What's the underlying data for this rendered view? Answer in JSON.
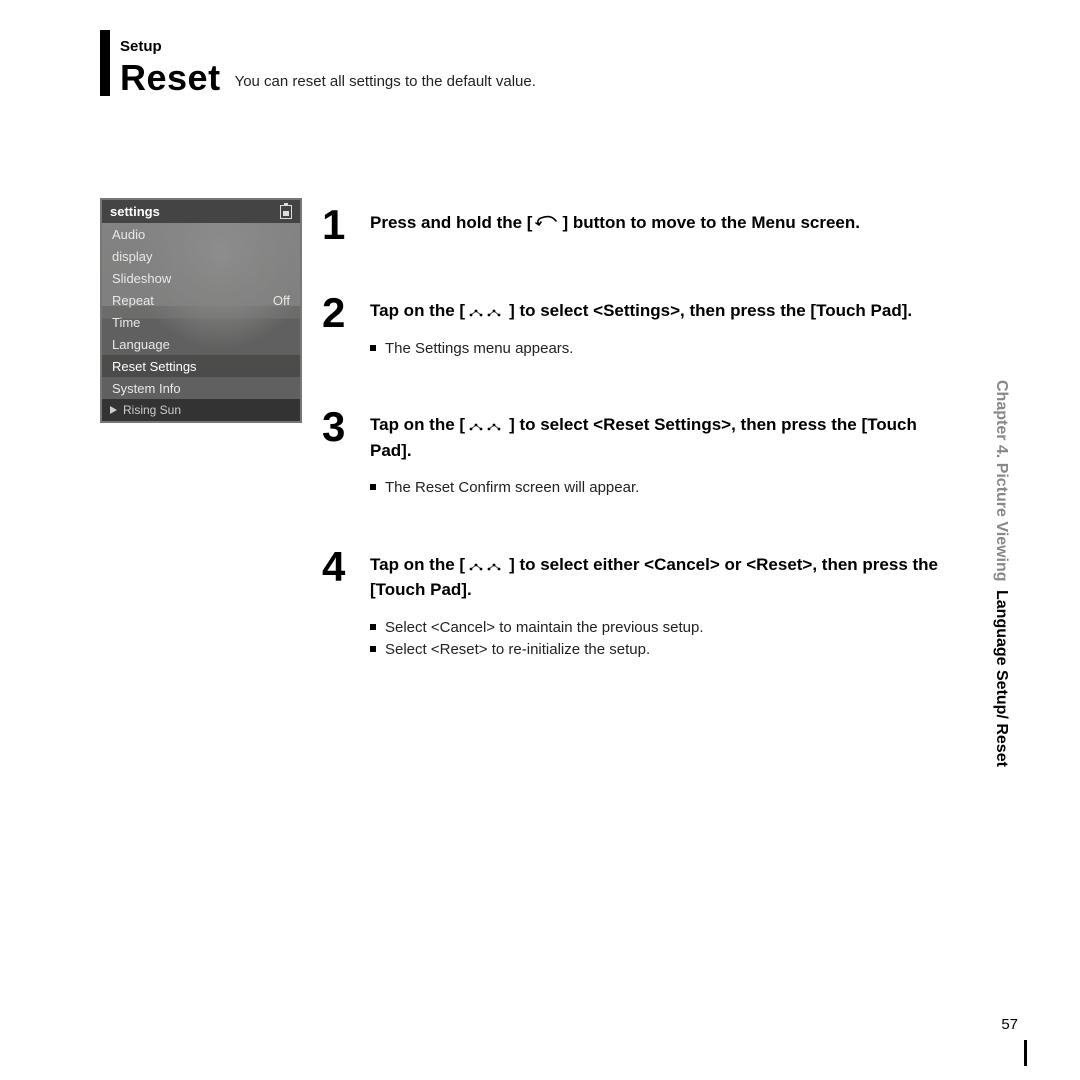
{
  "header": {
    "setup_label": "Setup",
    "title": "Reset",
    "subtitle": "You can reset all settings to the default value."
  },
  "device": {
    "header": "settings",
    "items": [
      {
        "label": "Audio",
        "value": ""
      },
      {
        "label": "display",
        "value": ""
      },
      {
        "label": "Slideshow",
        "value": ""
      },
      {
        "label": "Repeat",
        "value": "Off"
      },
      {
        "label": "Time",
        "value": ""
      },
      {
        "label": "Language",
        "value": ""
      },
      {
        "label": "Reset Settings",
        "value": "",
        "highlight": true
      },
      {
        "label": "System Info",
        "value": ""
      }
    ],
    "now_playing": "Rising Sun"
  },
  "steps": [
    {
      "num": "1",
      "title_pre": "Press and hold the [",
      "title_post": "] button to move to the Menu screen.",
      "icon": "back-arrow",
      "bullets": []
    },
    {
      "num": "2",
      "title_pre": "Tap on the [",
      "title_post": "] to select <Settings>,  then press the [Touch Pad].",
      "icon": "nav-dots",
      "bullets": [
        "The Settings menu appears."
      ]
    },
    {
      "num": "3",
      "title_pre": "Tap on the [",
      "title_post": "] to select <Reset Settings>, then press the [Touch Pad].",
      "icon": "nav-dots",
      "bullets": [
        "The Reset Confirm screen will appear."
      ]
    },
    {
      "num": "4",
      "title_pre": "Tap on the [",
      "title_post": "] to select either <Cancel> or <Reset>, then press the [Touch Pad].",
      "icon": "nav-dots",
      "bullets": [
        "Select <Cancel> to maintain the previous setup.",
        "Select <Reset> to re-initialize the setup."
      ]
    }
  ],
  "side": {
    "chapter": "Chapter 4. Picture Viewing",
    "section": "Language Setup/ Reset"
  },
  "page_number": "57"
}
